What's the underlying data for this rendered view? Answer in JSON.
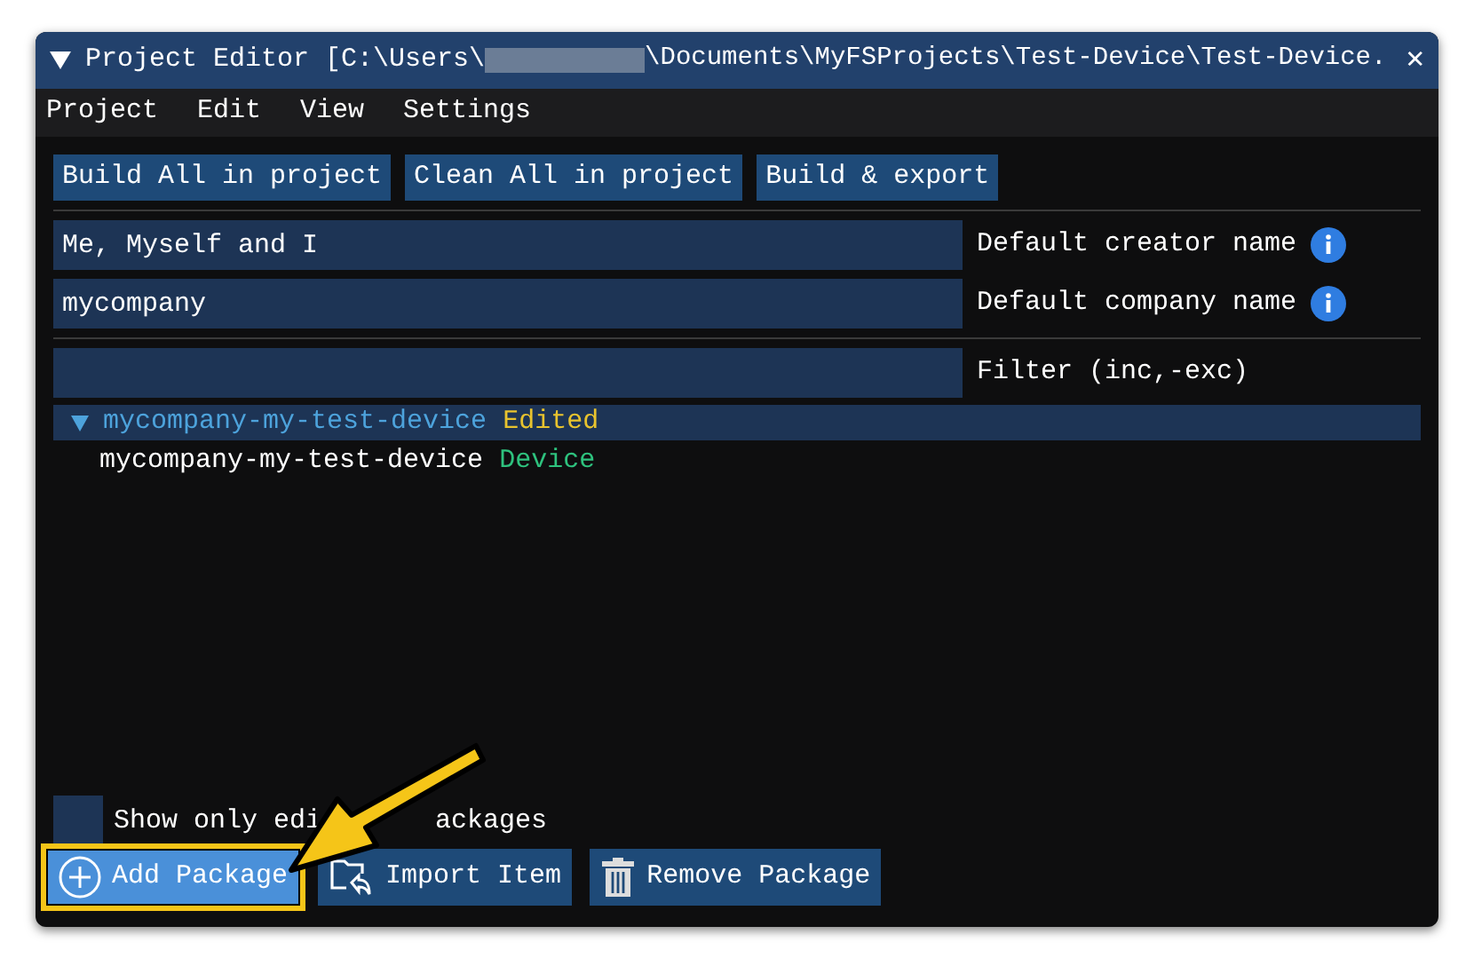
{
  "window": {
    "title_start": "Project Editor [C:\\Users\\",
    "title_end": "\\Documents\\MyFSProjects\\Test-Device\\Test-Device.",
    "close": "✕"
  },
  "menu": [
    "Project",
    "Edit",
    "View",
    "Settings"
  ],
  "toolbar": [
    "Build All in project",
    "Clean All in project",
    "Build & export"
  ],
  "fields": [
    {
      "value": "Me, Myself and I",
      "label": "Default creator name",
      "info": true
    },
    {
      "value": "mycompany",
      "label": "Default company name",
      "info": true
    },
    {
      "label": "Filter (inc,-exc)",
      "info": false
    }
  ],
  "tree": [
    {
      "name": "mycompany-my-test-device",
      "tag": "Edited",
      "color": "#e8c32e",
      "selected": true,
      "expanded": true,
      "children": [
        {
          "name": "mycompany-my-test-device",
          "tag": "Device",
          "color": "#2ec27e",
          "selected": false
        }
      ]
    }
  ],
  "show_only": {
    "label_parts": [
      "Show only edi",
      "ackages"
    ],
    "checked": false
  },
  "actions": [
    {
      "kind": "add",
      "label": "Add Package",
      "highlighted": true
    },
    {
      "kind": "import",
      "label": "Import Item",
      "highlighted": false
    },
    {
      "kind": "remove",
      "label": "Remove Package",
      "highlighted": false
    }
  ]
}
